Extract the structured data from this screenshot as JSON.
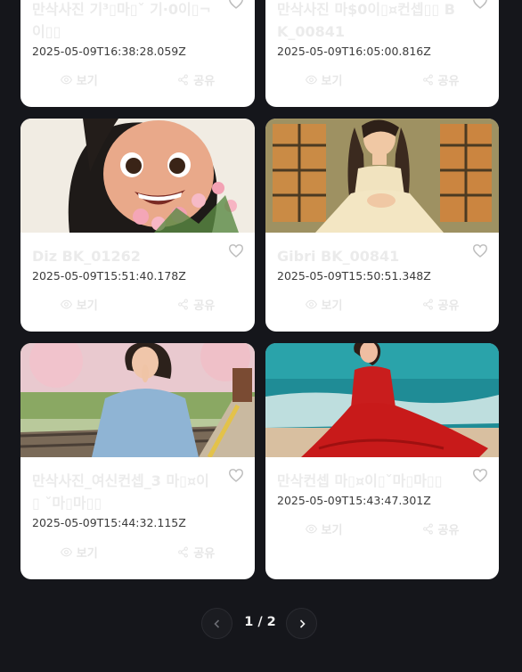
{
  "cards": [
    {
      "title": "만삭사진 기⁠³▯마▯ˇ 기·0이▯¬ 이▯▯",
      "date": "2025-05-09T16:38:28.059Z",
      "view": "보기",
      "share": "공유"
    },
    {
      "title": "만삭사진 마$0이▯¤컨셉▯▯ BK_00841",
      "date": "2025-05-09T16:05:00.816Z",
      "view": "보기",
      "share": "공유"
    },
    {
      "title": "Diz BK_01262",
      "date": "2025-05-09T15:51:40.178Z",
      "view": "보기",
      "share": "공유"
    },
    {
      "title": "Gibri BK_00841",
      "date": "2025-05-09T15:50:51.348Z",
      "view": "보기",
      "share": "공유"
    },
    {
      "title": "만삭사진_여신컨셉_3 마▯¤이▯ ˇ마▯마▯▯",
      "date": "2025-05-09T15:44:32.115Z",
      "view": "보기",
      "share": "공유"
    },
    {
      "title": "만삭컨셉 마▯¤이▯ˇ마▯마▯▯",
      "date": "2025-05-09T15:43:47.301Z",
      "view": "보기",
      "share": "공유"
    }
  ],
  "pagination": {
    "current_label": "1 / 2"
  },
  "icons": {
    "view": "eye-icon",
    "share": "share-icon",
    "like": "heart-icon",
    "prev": "chevron-left-icon",
    "next": "chevron-right-icon"
  },
  "colors": {
    "page_bg": "#15161b",
    "card_bg": "#ffffff",
    "muted_text": "#e6e6e6",
    "date_text": "#3b3b3b"
  }
}
